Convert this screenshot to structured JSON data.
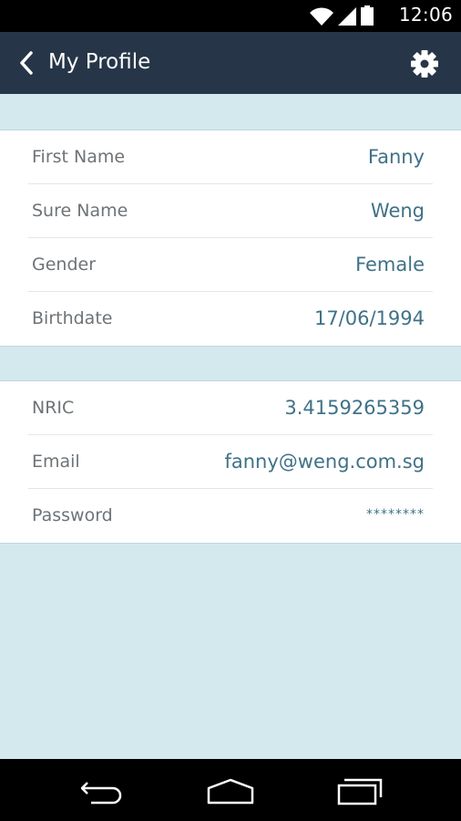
{
  "status_bar": {
    "time": "12:06",
    "icons": [
      "wifi-icon",
      "signal-icon",
      "battery-icon"
    ]
  },
  "app_bar": {
    "title": "My Profile",
    "back_icon": "chevron-left-icon",
    "settings_icon": "gear-icon"
  },
  "personal_section": {
    "rows": [
      {
        "label": "First Name",
        "value": "Fanny"
      },
      {
        "label": "Sure Name",
        "value": "Weng"
      },
      {
        "label": "Gender",
        "value": "Female"
      },
      {
        "label": "Birthdate",
        "value": "17/06/1994"
      }
    ]
  },
  "account_section": {
    "rows": [
      {
        "label": "NRIC",
        "value": "3.4159265359"
      },
      {
        "label": "Email",
        "value": "fanny@weng.com.sg"
      },
      {
        "label": "Password",
        "value": "********"
      }
    ]
  },
  "nav_bar": {
    "icons": [
      "back-nav-icon",
      "home-nav-icon",
      "recents-nav-icon"
    ]
  },
  "colors": {
    "app_bar": "#263648",
    "background": "#d3e9ed",
    "value_text": "#3f7287",
    "label_text": "#6e7377"
  }
}
